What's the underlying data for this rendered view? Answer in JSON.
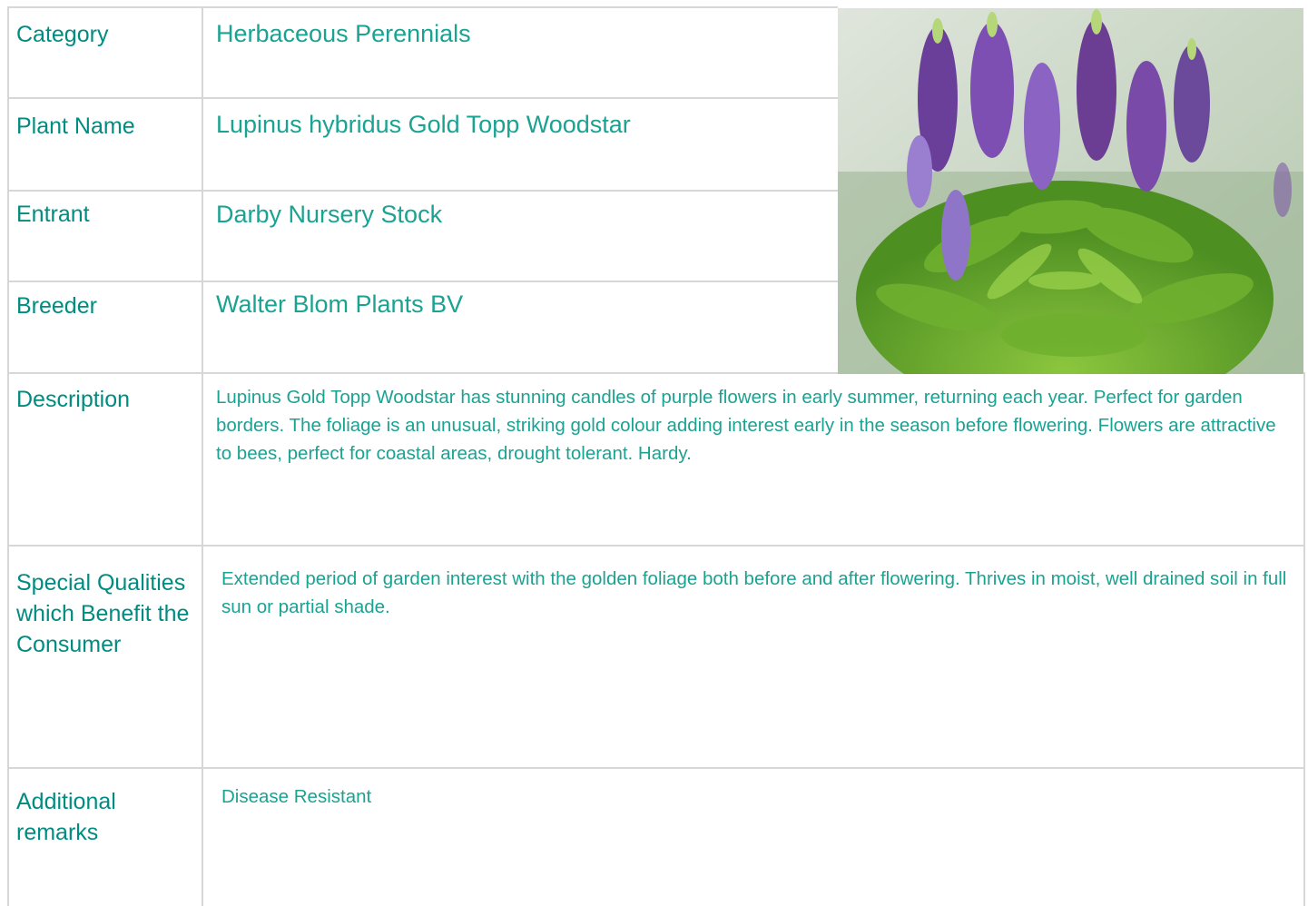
{
  "rows": {
    "category": {
      "label": "Category",
      "value": "Herbaceous Perennials"
    },
    "plant_name": {
      "label": "Plant Name",
      "value": "Lupinus hybridus Gold Topp Woodstar"
    },
    "entrant": {
      "label": "Entrant",
      "value": "Darby Nursery Stock"
    },
    "breeder": {
      "label": "Breeder",
      "value": "Walter Blom Plants BV"
    },
    "description": {
      "label": "Description",
      "value": "Lupinus Gold Topp Woodstar has stunning candles of purple flowers in early summer, returning each year. Perfect for garden borders. The foliage is an unusual, striking gold colour adding interest early in the season before flowering. Flowers are attractive to bees, perfect for coastal areas, drought tolerant. Hardy."
    },
    "special_qualities": {
      "label": "Special Qualities which Benefit the Consumer",
      "value": "Extended period of garden interest with the golden foliage both before and after flowering. Thrives in moist, well drained soil in full sun or partial shade."
    },
    "additional_remarks": {
      "label": "Additional remarks",
      "value": "Disease Resistant"
    }
  },
  "colors": {
    "label": "#008c80",
    "value": "#1aa392",
    "border": "#d7d7d7"
  }
}
